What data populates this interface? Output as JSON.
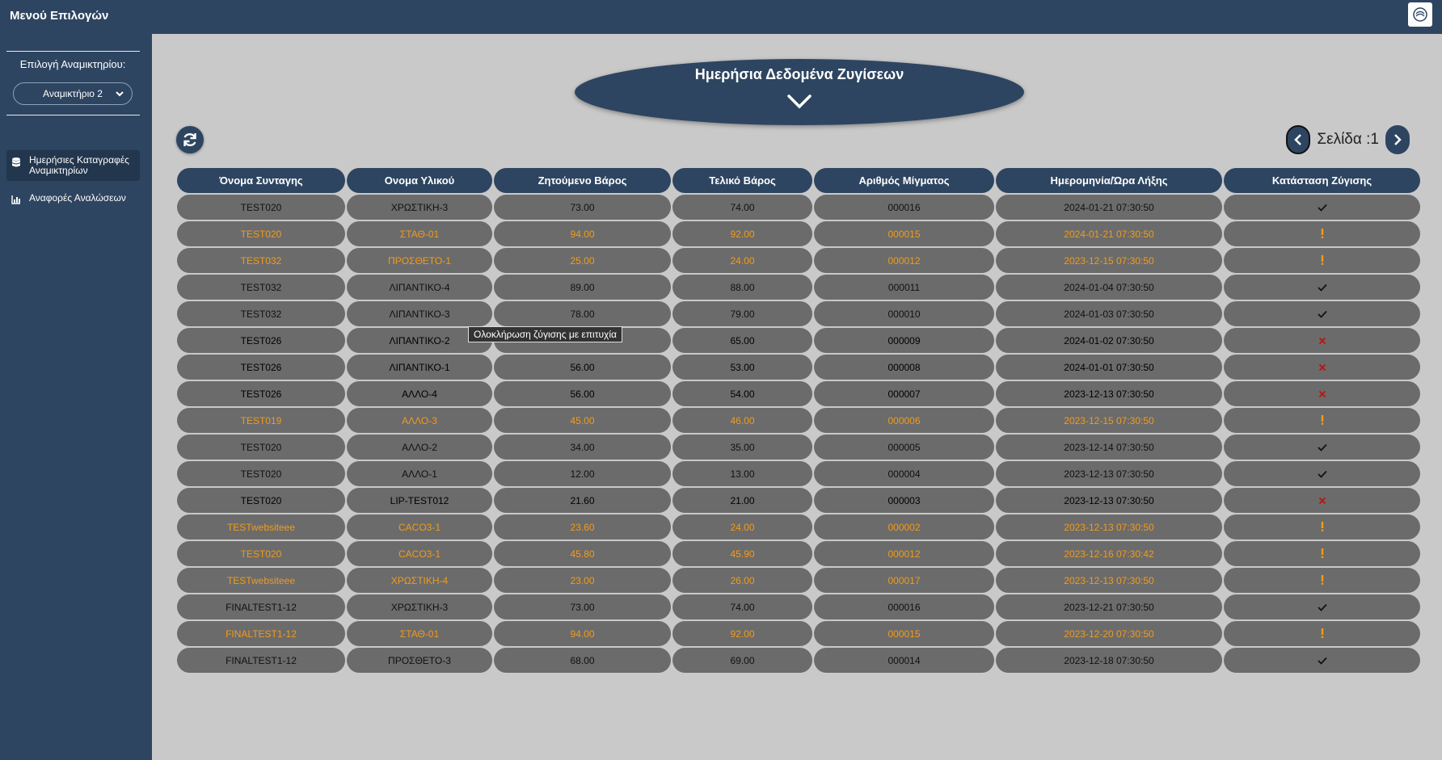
{
  "app": {
    "title": "Μενού Επιλογών"
  },
  "sidebar": {
    "mixer_label": "Επιλογή Αναμικτηρίου:",
    "mixer_selected": "Αναμικτήριο 2",
    "items": [
      {
        "label": "Ημερήσιες Καταγραφές Αναμικτηρίων",
        "icon": "database-icon",
        "active": true
      },
      {
        "label": "Αναφορές Αναλώσεων",
        "icon": "chart-icon",
        "active": false
      }
    ]
  },
  "banner": {
    "title": "Ημερήσια Δεδομένα Ζυγίσεων"
  },
  "pager": {
    "label": "Σελίδα :1"
  },
  "tooltip": {
    "text": "Ολοκλήρωση ζύγισης με επιτυχία"
  },
  "colors": {
    "primary": "#2e4561",
    "ok": "#111111",
    "warn": "#f29b1a",
    "error": "#c01010",
    "row_bg": "#6b6b6b",
    "page_bg": "#c9c9c9"
  },
  "table": {
    "headers": [
      "Όνομα Συνταγης",
      "Ονομα Υλικού",
      "Ζητούμενο Βάρος",
      "Τελικό Βάρος",
      "Αριθμός Μίγματος",
      "Ημερομηνία/Ώρα Λήξης",
      "Κατάσταση Ζύγισης"
    ],
    "rows": [
      {
        "recipe": "TEST020",
        "material": "ΧΡΩΣΤΙΚΗ-3",
        "requested": "73.00",
        "final": "74.00",
        "mix": "000016",
        "datetime": "2024-01-21 07:30:50",
        "status": "ok"
      },
      {
        "recipe": "TEST020",
        "material": "ΣΤΑΘ-01",
        "requested": "94.00",
        "final": "92.00",
        "mix": "000015",
        "datetime": "2024-01-21 07:30:50",
        "status": "warn"
      },
      {
        "recipe": "TEST032",
        "material": "ΠΡΟΣΘΕΤΟ-1",
        "requested": "25.00",
        "final": "24.00",
        "mix": "000012",
        "datetime": "2023-12-15 07:30:50",
        "status": "warn"
      },
      {
        "recipe": "TEST032",
        "material": "ΛΙΠΑΝΤΙΚΟ-4",
        "requested": "89.00",
        "final": "88.00",
        "mix": "000011",
        "datetime": "2024-01-04 07:30:50",
        "status": "ok"
      },
      {
        "recipe": "TEST032",
        "material": "ΛΙΠΑΝΤΙΚΟ-3",
        "requested": "78.00",
        "final": "79.00",
        "mix": "000010",
        "datetime": "2024-01-03 07:30:50",
        "status": "ok"
      },
      {
        "recipe": "TEST026",
        "material": "ΛΙΠΑΝΤΙΚΟ-2",
        "requested": "",
        "final": "65.00",
        "mix": "000009",
        "datetime": "2024-01-02 07:30:50",
        "status": "error"
      },
      {
        "recipe": "TEST026",
        "material": "ΛΙΠΑΝΤΙΚΟ-1",
        "requested": "56.00",
        "final": "53.00",
        "mix": "000008",
        "datetime": "2024-01-01 07:30:50",
        "status": "error"
      },
      {
        "recipe": "TEST026",
        "material": "ΑΛΛΟ-4",
        "requested": "56.00",
        "final": "54.00",
        "mix": "000007",
        "datetime": "2023-12-13 07:30:50",
        "status": "error"
      },
      {
        "recipe": "TEST019",
        "material": "ΑΛΛΟ-3",
        "requested": "45.00",
        "final": "46.00",
        "mix": "000006",
        "datetime": "2023-12-15 07:30:50",
        "status": "warn"
      },
      {
        "recipe": "TEST020",
        "material": "ΑΛΛΟ-2",
        "requested": "34.00",
        "final": "35.00",
        "mix": "000005",
        "datetime": "2023-12-14 07:30:50",
        "status": "ok"
      },
      {
        "recipe": "TEST020",
        "material": "ΑΛΛΟ-1",
        "requested": "12.00",
        "final": "13.00",
        "mix": "000004",
        "datetime": "2023-12-13 07:30:50",
        "status": "ok"
      },
      {
        "recipe": "TEST020",
        "material": "LIP-TEST012",
        "requested": "21.60",
        "final": "21.00",
        "mix": "000003",
        "datetime": "2023-12-13 07:30:50",
        "status": "error"
      },
      {
        "recipe": "TESTwebsiteee",
        "material": "CACO3-1",
        "requested": "23.60",
        "final": "24.00",
        "mix": "000002",
        "datetime": "2023-12-13 07:30:50",
        "status": "warn"
      },
      {
        "recipe": "TEST020",
        "material": "CACO3-1",
        "requested": "45.80",
        "final": "45.90",
        "mix": "000012",
        "datetime": "2023-12-16 07:30:42",
        "status": "warn"
      },
      {
        "recipe": "TESTwebsiteee",
        "material": "ΧΡΩΣΤΙΚΗ-4",
        "requested": "23.00",
        "final": "26.00",
        "mix": "000017",
        "datetime": "2023-12-13 07:30:50",
        "status": "warn"
      },
      {
        "recipe": "FINALTEST1-12",
        "material": "ΧΡΩΣΤΙΚΗ-3",
        "requested": "73.00",
        "final": "74.00",
        "mix": "000016",
        "datetime": "2023-12-21 07:30:50",
        "status": "ok"
      },
      {
        "recipe": "FINALTEST1-12",
        "material": "ΣΤΑΘ-01",
        "requested": "94.00",
        "final": "92.00",
        "mix": "000015",
        "datetime": "2023-12-20 07:30:50",
        "status": "warn"
      },
      {
        "recipe": "FINALTEST1-12",
        "material": "ΠΡΟΣΘΕΤΟ-3",
        "requested": "68.00",
        "final": "69.00",
        "mix": "000014",
        "datetime": "2023-12-18 07:30:50",
        "status": "ok"
      }
    ]
  }
}
